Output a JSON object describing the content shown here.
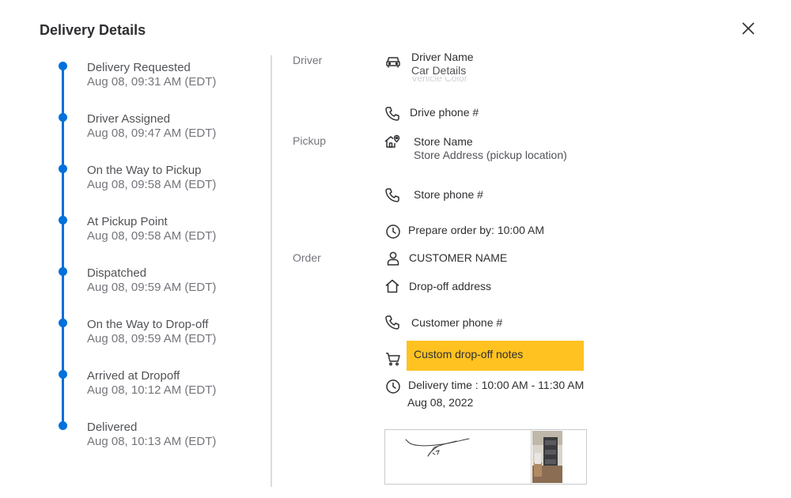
{
  "dialog": {
    "title": "Delivery Details"
  },
  "timeline": [
    {
      "label": "Delivery Requested",
      "time": "Aug 08, 09:31 AM (EDT)"
    },
    {
      "label": "Driver Assigned",
      "time": "Aug 08, 09:47 AM (EDT)"
    },
    {
      "label": "On the Way to Pickup",
      "time": "Aug 08, 09:58 AM (EDT)"
    },
    {
      "label": "At Pickup Point",
      "time": "Aug 08, 09:58 AM (EDT)"
    },
    {
      "label": "Dispatched",
      "time": "Aug 08, 09:59 AM (EDT)"
    },
    {
      "label": "On the Way to Drop-off",
      "time": "Aug 08, 09:59 AM (EDT)"
    },
    {
      "label": "Arrived at Dropoff",
      "time": "Aug 08, 10:12 AM (EDT)"
    },
    {
      "label": "Delivered",
      "time": "Aug 08, 10:13 AM (EDT)"
    }
  ],
  "driver": {
    "section_label": "Driver",
    "name": "Driver Name",
    "car": "Car Details",
    "partial": "Vehicle Color",
    "phone": "Drive phone #"
  },
  "pickup": {
    "section_label": "Pickup",
    "store_name": "Store Name",
    "store_address": "Store Address (pickup location)",
    "store_phone": "Store phone #",
    "prepare_by": "Prepare order by: 10:00 AM"
  },
  "order": {
    "section_label": "Order",
    "customer_name": "CUSTOMER NAME",
    "dropoff_address": "Drop-off address",
    "customer_phone": "Customer phone #",
    "notes": "Custom drop-off notes",
    "delivery_time": "Delivery time : 10:00 AM - 11:30 AM",
    "delivery_date": "Aug 08, 2022"
  },
  "colors": {
    "accent": "#0071dc",
    "highlight": "#ffc220"
  },
  "icons": [
    "car-icon",
    "phone-icon",
    "store-icon",
    "clock-icon",
    "person-icon",
    "house-icon",
    "cart-icon",
    "close-icon"
  ]
}
